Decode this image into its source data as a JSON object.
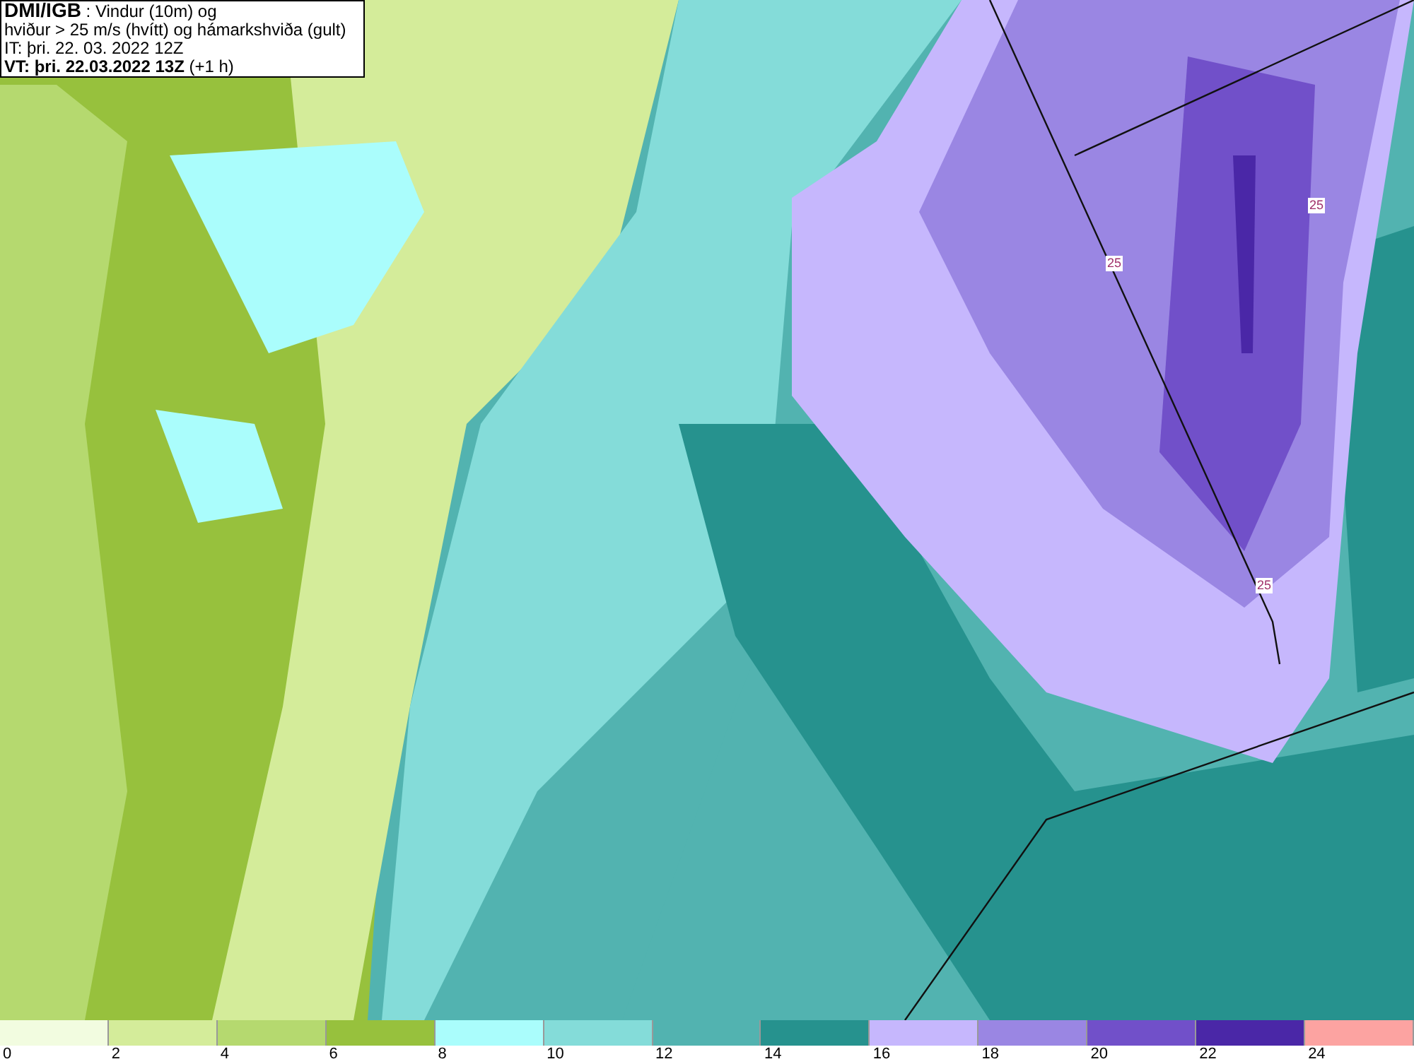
{
  "header": {
    "source": "DMI/IGB",
    "title_rest": " : Vindur (10m) og",
    "line_2": "hviður > 25 m/s (hvítt) og hámarkshviða (gult)",
    "issue_time": "IT: þri. 22. 03. 2022 12Z",
    "valid_time": "VT: þri. 22.03.2022 13Z",
    "valid_offset": " (+1 h)"
  },
  "map": {
    "contour_labels": [
      "25",
      "25",
      "25"
    ]
  },
  "legend": {
    "bands": [
      {
        "color": "#f2fce0"
      },
      {
        "color": "#d4ec9a"
      },
      {
        "color": "#b5d96f"
      },
      {
        "color": "#97c13d"
      },
      {
        "color": "#aafdfc"
      },
      {
        "color": "#84dcd9"
      },
      {
        "color": "#52b3b0"
      },
      {
        "color": "#26928e"
      },
      {
        "color": "#c6b7fd"
      },
      {
        "color": "#9a86e3"
      },
      {
        "color": "#7150c9"
      },
      {
        "color": "#4a27a7"
      },
      {
        "color": "#fca3a1"
      }
    ],
    "labels": [
      "0",
      "2",
      "4",
      "6",
      "8",
      "10",
      "12",
      "14",
      "16",
      "18",
      "20",
      "22",
      "24"
    ]
  }
}
